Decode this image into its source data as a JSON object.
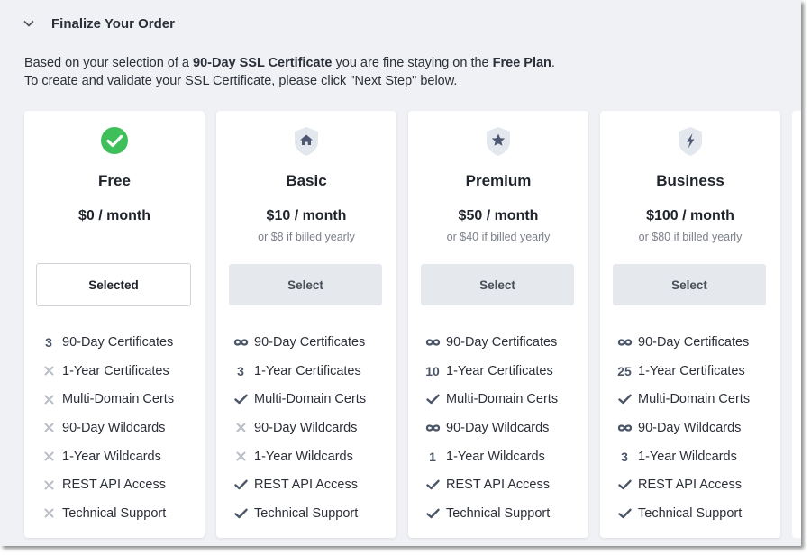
{
  "section": {
    "title": "Finalize Your Order",
    "desc_line1_prefix": "Based on your selection of a ",
    "desc_line1_bold1": "90-Day SSL Certificate",
    "desc_line1_mid": " you are fine staying on the ",
    "desc_line1_bold2": "Free Plan",
    "desc_line1_suffix": ".",
    "desc_line2": "To create and validate your SSL Certificate, please click \"Next Step\" below."
  },
  "colors": {
    "check_green": "#3fbf5a",
    "shield_bg": "#e3e7ee",
    "shield_icon": "#4d5672",
    "icon_dark": "#4a5568",
    "icon_light": "#b9bdc6"
  },
  "features": [
    "90-Day Certificates",
    "1-Year Certificates",
    "Multi-Domain Certs",
    "90-Day Wildcards",
    "1-Year Wildcards",
    "REST API Access",
    "Technical Support"
  ],
  "plans": [
    {
      "name": "Free",
      "price": "$0 / month",
      "yearly": "",
      "button": "Selected",
      "selected": true,
      "icon": "check-circle-icon",
      "marks": [
        "3",
        "cross",
        "cross",
        "cross",
        "cross",
        "cross",
        "cross"
      ]
    },
    {
      "name": "Basic",
      "price": "$10 / month",
      "yearly": "or $8 if billed yearly",
      "button": "Select",
      "selected": false,
      "icon": "house-shield-icon",
      "marks": [
        "infinity",
        "3",
        "check",
        "cross",
        "cross",
        "check",
        "check"
      ]
    },
    {
      "name": "Premium",
      "price": "$50 / month",
      "yearly": "or $40 if billed yearly",
      "button": "Select",
      "selected": false,
      "icon": "star-shield-icon",
      "marks": [
        "infinity",
        "10",
        "check",
        "infinity",
        "1",
        "check",
        "check"
      ]
    },
    {
      "name": "Business",
      "price": "$100 / month",
      "yearly": "or $80 if billed yearly",
      "button": "Select",
      "selected": false,
      "icon": "bolt-shield-icon",
      "marks": [
        "infinity",
        "25",
        "check",
        "infinity",
        "3",
        "check",
        "check"
      ]
    }
  ]
}
